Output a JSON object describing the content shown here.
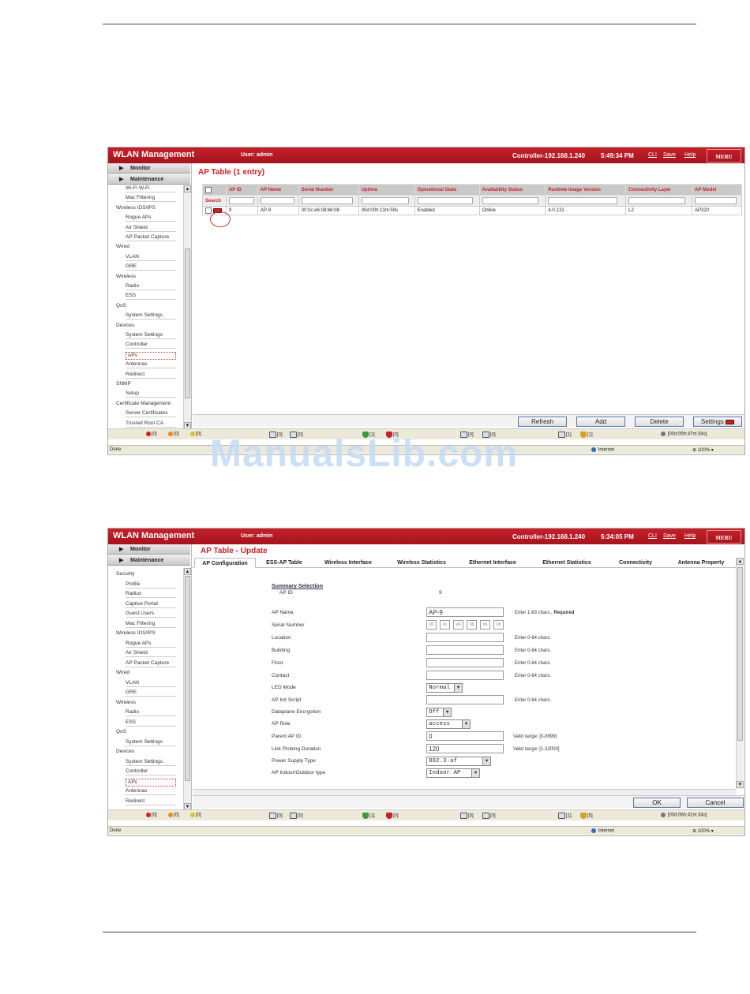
{
  "brand": {
    "accent": "#c8202a",
    "header": "#a3141d"
  },
  "watermark": "ManualsLib.com",
  "screen1": {
    "app_title": "WLAN Management",
    "user": "User: admin",
    "controller": "Controller-192.168.1.240",
    "time": "5:49:34 PM",
    "links": [
      "CLI",
      "Save",
      "Help"
    ],
    "logo": "MERU",
    "nav": {
      "monitor": "Monitor",
      "maintenance": "Maintenance"
    },
    "tree": [
      {
        "type": "i",
        "label": "Wi-Fi W-Fi"
      },
      {
        "type": "i",
        "label": "Mac Filtering"
      },
      {
        "type": "g",
        "label": "Wireless IDS/IPS"
      },
      {
        "type": "i",
        "label": "Rogue APs"
      },
      {
        "type": "i",
        "label": "Air Shield"
      },
      {
        "type": "i",
        "label": "AP Packet Capture"
      },
      {
        "type": "g",
        "label": "Wired"
      },
      {
        "type": "i",
        "label": "VLAN"
      },
      {
        "type": "i",
        "label": "GRE"
      },
      {
        "type": "g",
        "label": "Wireless"
      },
      {
        "type": "i",
        "label": "Radio"
      },
      {
        "type": "i",
        "label": "ESS"
      },
      {
        "type": "g",
        "label": "QoS"
      },
      {
        "type": "i",
        "label": "System Settings"
      },
      {
        "type": "g",
        "label": "Devices"
      },
      {
        "type": "i",
        "label": "System Settings"
      },
      {
        "type": "i",
        "label": "Controller"
      },
      {
        "type": "i",
        "label": "APs",
        "selected": true
      },
      {
        "type": "i",
        "label": "Antennas"
      },
      {
        "type": "i",
        "label": "Redirect"
      },
      {
        "type": "g",
        "label": "SNMP"
      },
      {
        "type": "i",
        "label": "Setup"
      },
      {
        "type": "g",
        "label": "Certificate Management"
      },
      {
        "type": "i",
        "label": "Server Certificates"
      },
      {
        "type": "i",
        "label": "Trusted Root CA"
      }
    ],
    "page_title": "AP Table (1 entry)",
    "table": {
      "search_label": "Search",
      "columns": [
        "AP ID",
        "AP Name",
        "Serial Number",
        "Uptime",
        "Operational State",
        "Availability Status",
        "Runtime Image Version",
        "Connectivity Layer",
        "AP Model"
      ],
      "rows": [
        [
          "9",
          "AP-9",
          "00:0c:e6:08:b6:08",
          "00d:00h:13m:59s",
          "Enabled",
          "Online",
          "4.0-131",
          "L2",
          "AP320"
        ]
      ]
    },
    "buttons": {
      "refresh": "Refresh",
      "add": "Add",
      "delete": "Delete",
      "settings": "Settings"
    },
    "status": {
      "r": "[0]",
      "o": "[0]",
      "y": "[0]",
      "a1": "[0]",
      "a2": "[0]",
      "s1": "[1]",
      "s2": "[0]",
      "d1": "[0]",
      "d2": "[0]",
      "m1": "[1]",
      "m2": "[1]",
      "clock": "[00d:05h:47m:34s]"
    },
    "ie": {
      "left": "Done",
      "zone": "Internet",
      "zoom": "100%"
    }
  },
  "screen2": {
    "app_title": "WLAN Management",
    "user": "User: admin",
    "controller": "Controller-192.168.1.240",
    "time": "5:34:05 PM",
    "links": [
      "CLI",
      "Save",
      "Help"
    ],
    "logo": "MERU",
    "nav": {
      "monitor": "Monitor",
      "maintenance": "Maintenance"
    },
    "tree": [
      {
        "type": "g",
        "label": "Security"
      },
      {
        "type": "i",
        "label": "Profile"
      },
      {
        "type": "i",
        "label": "Radius"
      },
      {
        "type": "i",
        "label": "Captive Portal"
      },
      {
        "type": "i",
        "label": "Guest Users"
      },
      {
        "type": "i",
        "label": "Mac Filtering"
      },
      {
        "type": "g",
        "label": "Wireless IDS/IPS"
      },
      {
        "type": "i",
        "label": "Rogue APs"
      },
      {
        "type": "i",
        "label": "Air Shield"
      },
      {
        "type": "i",
        "label": "AP Packet Capture"
      },
      {
        "type": "g",
        "label": "Wired"
      },
      {
        "type": "i",
        "label": "VLAN"
      },
      {
        "type": "i",
        "label": "GRE"
      },
      {
        "type": "g",
        "label": "Wireless"
      },
      {
        "type": "i",
        "label": "Radio"
      },
      {
        "type": "i",
        "label": "ESS"
      },
      {
        "type": "g",
        "label": "QoS"
      },
      {
        "type": "i",
        "label": "System Settings"
      },
      {
        "type": "g",
        "label": "Devices"
      },
      {
        "type": "i",
        "label": "System Settings"
      },
      {
        "type": "i",
        "label": "Controller"
      },
      {
        "type": "i",
        "label": "APs",
        "selected": true
      },
      {
        "type": "i",
        "label": "Antennas"
      },
      {
        "type": "i",
        "label": "Redirect"
      }
    ],
    "page_title": "AP Table - Update",
    "tabs": [
      "AP Configuration",
      "ESS-AP Table",
      "Wireless Interface",
      "Wireless Statistics",
      "Ethernet Interface",
      "Ethernet Statistics",
      "Connectivity",
      "Antenna Property"
    ],
    "summary": {
      "heading": "Summary Selection",
      "ap_id_label": "AP ID",
      "ap_id_value": "9"
    },
    "fields": {
      "ap_name": {
        "label": "AP Name",
        "value": "AP-9",
        "hint": "Enter 1-63 chars.,",
        "req": "Required"
      },
      "serial": {
        "label": "Serial Number",
        "octets": [
          "00",
          "0c",
          "e6",
          "08",
          "b6",
          "08"
        ]
      },
      "location": {
        "label": "Location",
        "hint": "Enter 0-64 chars."
      },
      "building": {
        "label": "Building",
        "hint": "Enter 0-64 chars."
      },
      "floor": {
        "label": "Floor",
        "hint": "Enter 0-64 chars."
      },
      "contact": {
        "label": "Contact",
        "hint": "Enter 0-64 chars."
      },
      "led": {
        "label": "LED Mode",
        "value": "Normal"
      },
      "init": {
        "label": "AP Init Script",
        "hint": "Enter 0-64 chars."
      },
      "dataplane": {
        "label": "Dataplane Encryption",
        "value": "Off"
      },
      "role": {
        "label": "AP Role",
        "value": "access"
      },
      "parent": {
        "label": "Parent AP ID",
        "value": "0",
        "hint": "Valid range: [0-9999]"
      },
      "probing": {
        "label": "Link Probing Duration",
        "value": "120",
        "hint": "Valid range: [1-32000]"
      },
      "power": {
        "label": "Power Supply Type",
        "value": "802.3-af"
      },
      "indoor": {
        "label": "AP Indoor/Outdoor type",
        "value": "Indoor AP"
      }
    },
    "buttons": {
      "ok": "OK",
      "cancel": "Cancel"
    },
    "status": {
      "r": "[0]",
      "o": "[0]",
      "y": "[0]",
      "a1": "[0]",
      "a2": "[0]",
      "s1": "[1]",
      "s2": "[0]",
      "d1": "[0]",
      "d2": "[0]",
      "m1": "[1]",
      "m2": "[5]",
      "clock": "[00d:06h:41m:34s]"
    },
    "ie": {
      "left": "Done",
      "zone": "Internet",
      "zoom": "100%"
    }
  }
}
